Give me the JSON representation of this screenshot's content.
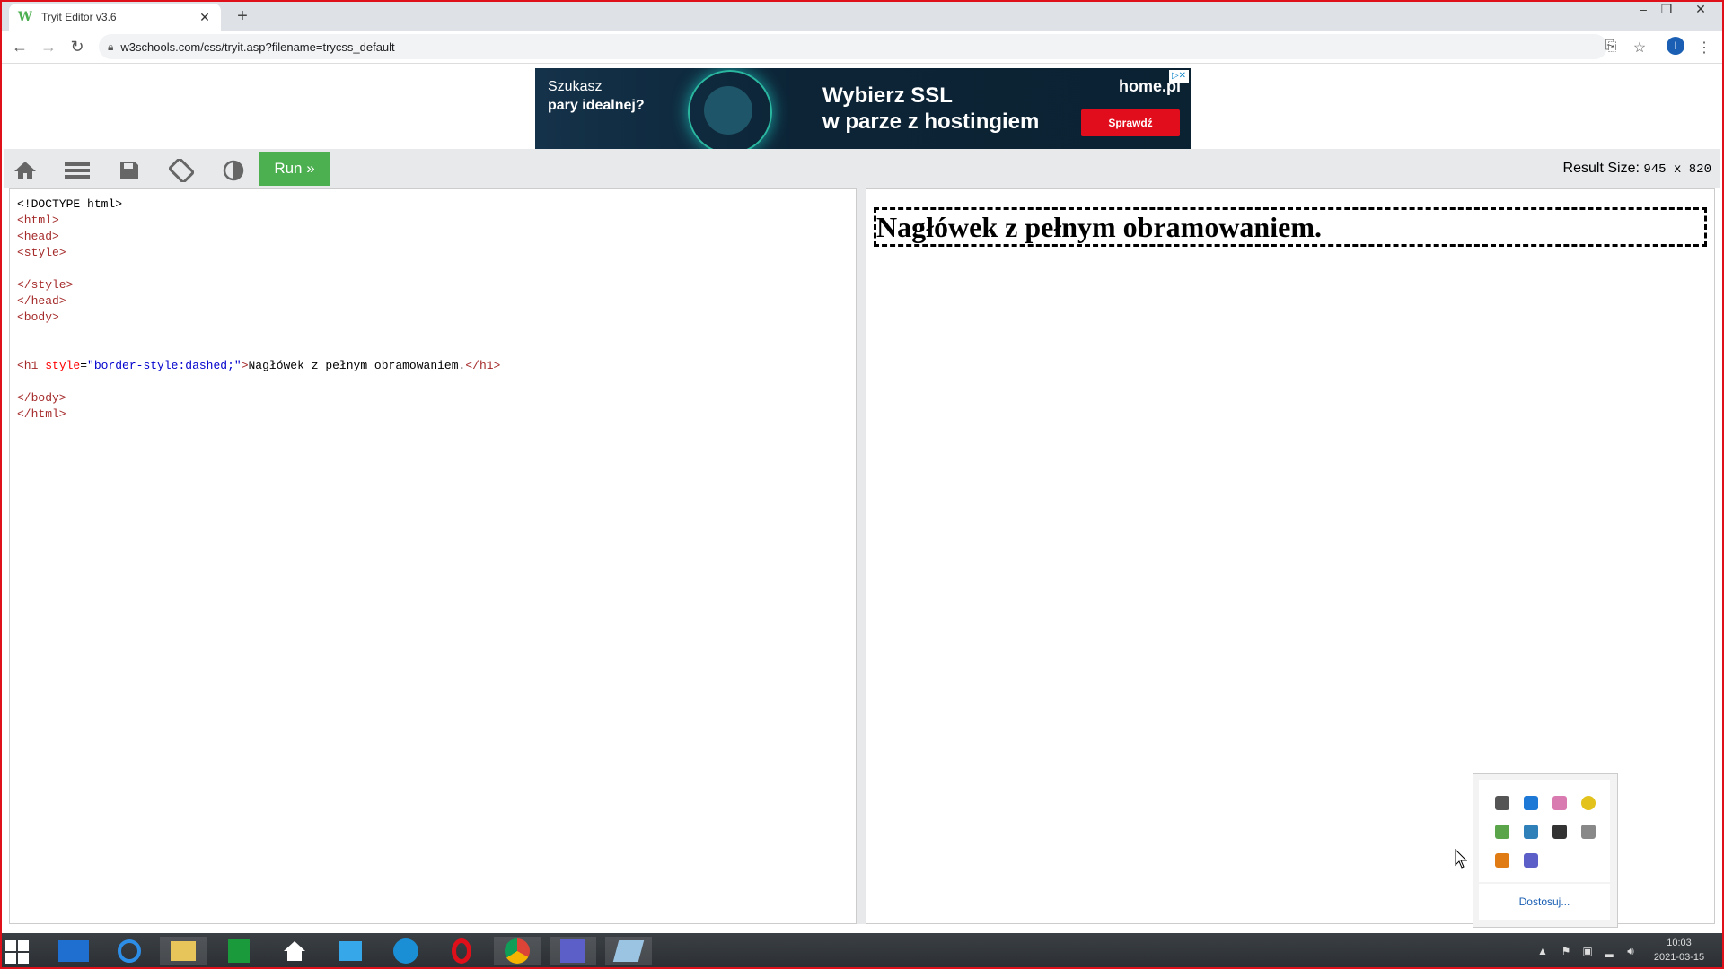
{
  "browser": {
    "tab_title": "Tryit Editor v3.6",
    "tab_favicon": "W",
    "url": "w3schools.com/css/tryit.asp?filename=trycss_default",
    "profile_initial": "I"
  },
  "ad": {
    "left_text_1": "Szukasz",
    "left_text_2": "pary idealnej?",
    "headline_1": "Wybierz SSL",
    "headline_2": "w parze z hostingiem",
    "brand": "home.pl",
    "cta": "Sprawdź"
  },
  "editor_toolbar": {
    "run_label": "Run »",
    "result_size_label": "Result Size:",
    "result_size_value": "945 x 820"
  },
  "code": {
    "lines": [
      "<!DOCTYPE html>",
      "<html>",
      "<head>",
      "<style>",
      "",
      "</style>",
      "</head>",
      "<body>",
      "",
      "",
      "<h1 style=\"border-style:dashed;\">Nagłówek z pełnym obramowaniem.</h1>",
      "",
      "</body>",
      "</html>"
    ]
  },
  "result": {
    "heading": "Nagłówek z pełnym obramowaniem."
  },
  "tray_popup": {
    "customize_label": "Dostosuj..."
  },
  "taskbar": {
    "time": "10:03",
    "date": "2021-03-15"
  },
  "colors": {
    "run_button": "#4caf50",
    "toolbar_bg": "#e7e9eb",
    "ad_cta": "#e10d1c",
    "frame_border": "#e0101a"
  }
}
